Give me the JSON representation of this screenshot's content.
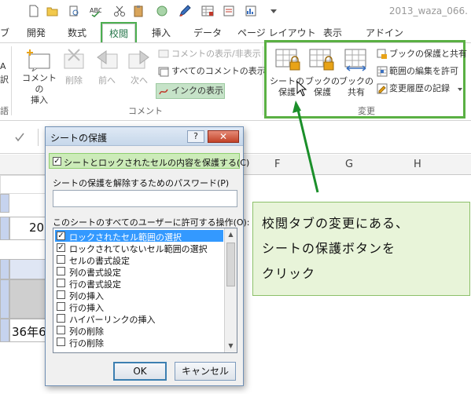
{
  "window": {
    "file_title": "2013_waza_066."
  },
  "ribbon_tabs": [
    {
      "label": "ブ"
    },
    {
      "label": "開発"
    },
    {
      "label": "数式"
    },
    {
      "label": "校閲"
    },
    {
      "label": "挿入"
    },
    {
      "label": "データ"
    },
    {
      "label": "ページ レイアウト"
    },
    {
      "label": "表示"
    },
    {
      "label": "アドイン"
    }
  ],
  "ribbon": {
    "partial_left": [
      "A",
      "訳"
    ],
    "partial_group": "語",
    "new_comment": "コメントの\n挿入",
    "delete": "削除",
    "previous": "前へ",
    "next": "次へ",
    "show_hide_comment": "コメントの表示/非表示",
    "show_all_comments": "すべてのコメントの表示",
    "show_ink": "インクの表示",
    "comment_group": "コメント",
    "protect_sheet": "シートの\n保護",
    "protect_workbook": "ブックの\n保護",
    "share_workbook": "ブックの\n共有",
    "protect_and_share": "ブックの保護と共有",
    "allow_edit_ranges": "範囲の編集を許可",
    "track_changes": "変更履歴の記録",
    "changes_group": "変更"
  },
  "sheet": {
    "columns": [
      "F",
      "G",
      "H"
    ],
    "cells": [
      "20",
      "36年6"
    ]
  },
  "dialog": {
    "title": "シートの保護",
    "help": "?",
    "close": "✕",
    "protect_label": "シートとロックされたセルの内容を保護する(C)",
    "password_label": "シートの保護を解除するためのパスワード(P)",
    "password_value": "",
    "allow_label": "このシートのすべてのユーザーに許可する操作(O):",
    "options": [
      {
        "label": "ロックされたセル範囲の選択",
        "checked": true,
        "selected": true
      },
      {
        "label": "ロックされていないセル範囲の選択",
        "checked": true,
        "selected": false
      },
      {
        "label": "セルの書式設定",
        "checked": false,
        "selected": false
      },
      {
        "label": "列の書式設定",
        "checked": false,
        "selected": false
      },
      {
        "label": "行の書式設定",
        "checked": false,
        "selected": false
      },
      {
        "label": "列の挿入",
        "checked": false,
        "selected": false
      },
      {
        "label": "行の挿入",
        "checked": false,
        "selected": false
      },
      {
        "label": "ハイパーリンクの挿入",
        "checked": false,
        "selected": false
      },
      {
        "label": "列の削除",
        "checked": false,
        "selected": false
      },
      {
        "label": "行の削除",
        "checked": false,
        "selected": false
      }
    ],
    "ok": "OK",
    "cancel": "キャンセル"
  },
  "callout": {
    "lines": [
      "校閲タブの変更にある、",
      "シートの保護ボタンを",
      "クリック"
    ]
  },
  "colors": {
    "highlight_green": "#5ab043",
    "callout_bg": "#e8f4d9",
    "selection_blue": "#3399ff"
  }
}
